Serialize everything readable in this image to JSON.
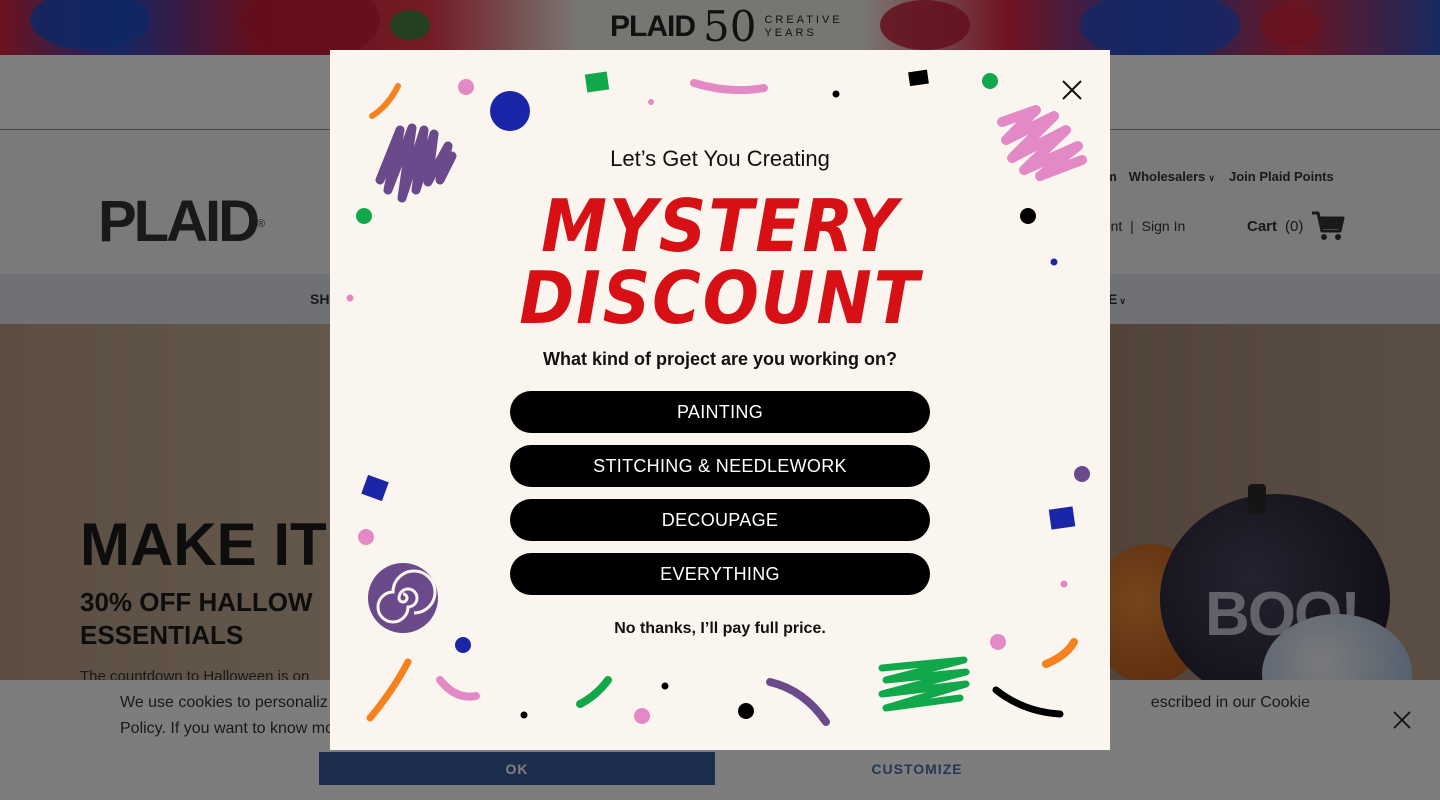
{
  "banner": {
    "brand": "PLAID",
    "anniversary_number": "50",
    "anniversary_line1": "CREATIVE",
    "anniversary_line2": "YEARS"
  },
  "header": {
    "logo": "PLAID",
    "logo_mark": "®",
    "util_links": [
      "am",
      "Wholesalers",
      "Join Plaid Points"
    ],
    "account": "count",
    "sign_in": "Sign In",
    "separator": "|",
    "cart_label": "Cart",
    "cart_count": "(0)"
  },
  "nav": {
    "left_label": "SH",
    "right_label": "E"
  },
  "hero": {
    "title": "MAKE IT",
    "subtitle": "30% OFF HALLOW ESSENTIALS",
    "body": "The countdown to Halloween is on",
    "decor_text": "BOO!"
  },
  "cookie": {
    "text_line1": "We use cookies to personaliz",
    "text_line1_end": "escribed in our Cookie",
    "text_line2": "Policy. If you want to know mo",
    "ok_label": "OK",
    "customize_label": "CUSTOMIZE"
  },
  "modal": {
    "eyebrow": "Let’s Get You Creating",
    "headline_line1": "MYSTERY",
    "headline_line2": "DISCOUNT",
    "question": "What kind of project are you working on?",
    "choices": [
      "PAINTING",
      "STITCHING & NEEDLEWORK",
      "DECOUPAGE",
      "EVERYTHING"
    ],
    "decline": "No thanks, I’ll pay full price.",
    "accent_color": "#d71015"
  }
}
